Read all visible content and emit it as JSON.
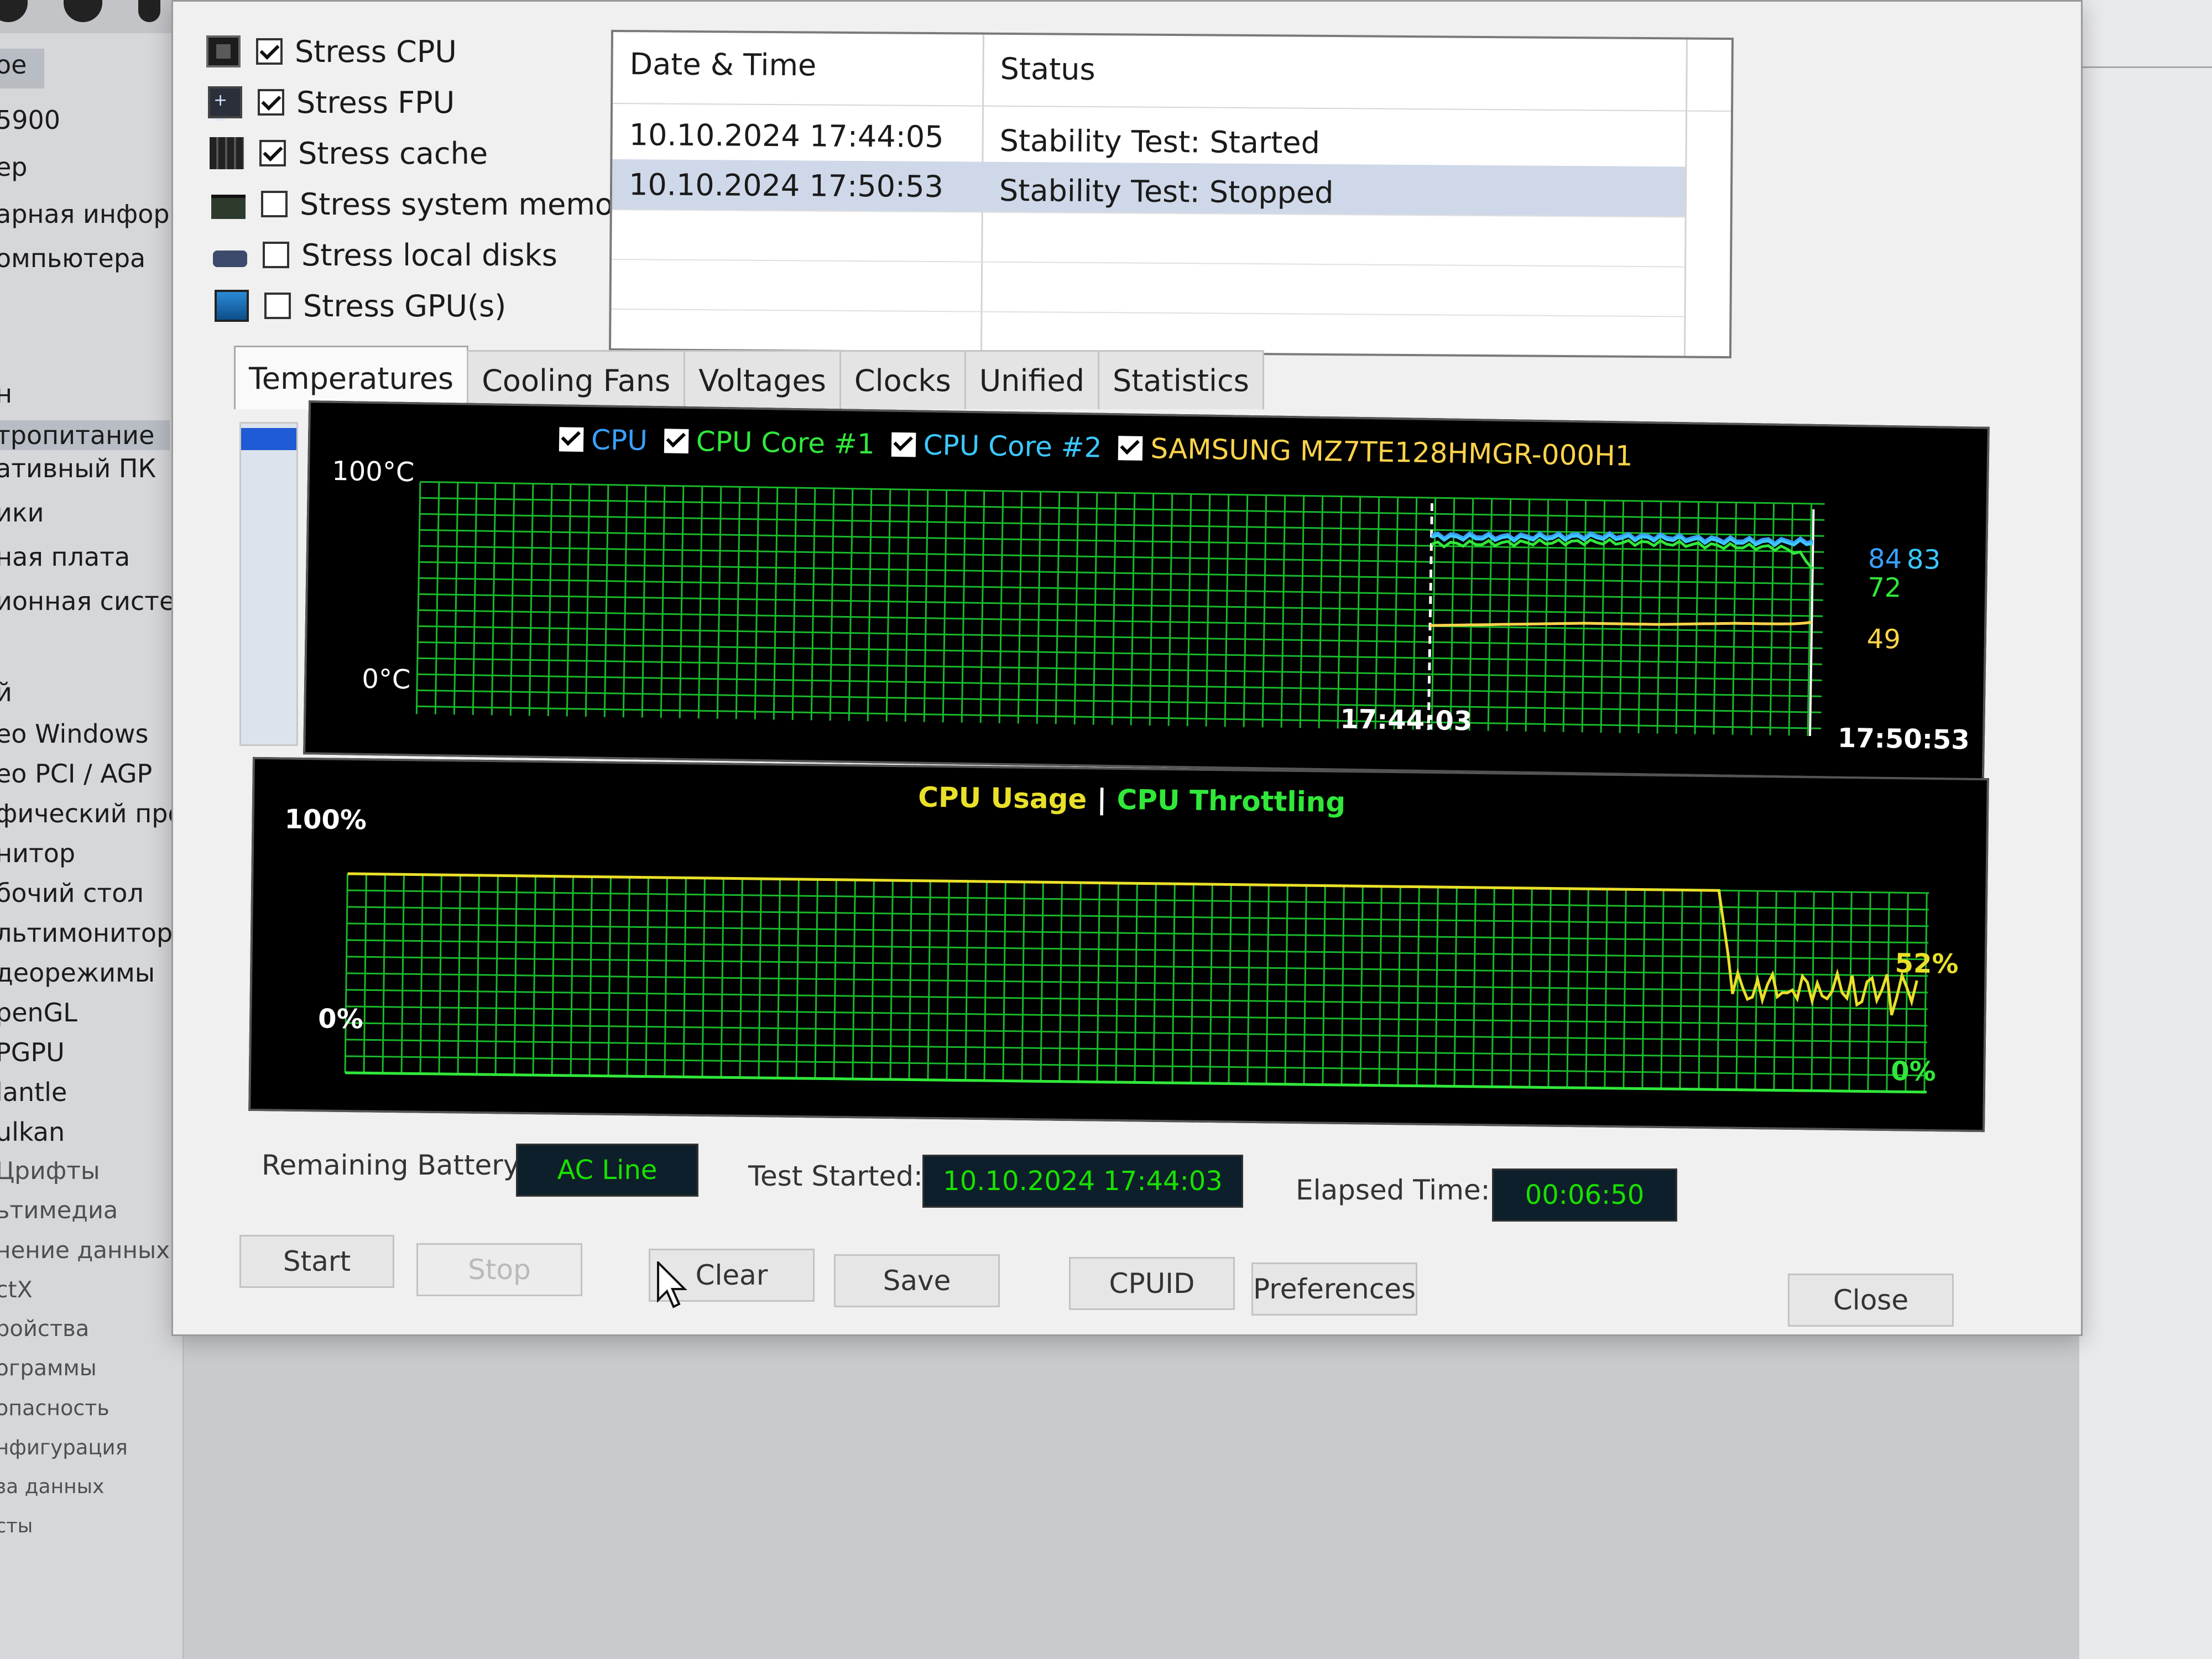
{
  "sidebar": {
    "items": [
      {
        "label": "ое",
        "active": true
      },
      {
        "label": "5900"
      },
      {
        "label": "ер"
      },
      {
        "label": "арная инфор"
      },
      {
        "label": "омпьютера"
      },
      {
        "label": "н"
      },
      {
        "label": "тропитание",
        "active": true
      },
      {
        "label": "ативный ПК"
      },
      {
        "label": "ики"
      },
      {
        "label": "ная плата"
      },
      {
        "label": "ионная систем"
      },
      {
        "label": "й"
      },
      {
        "label": "ео Windows"
      },
      {
        "label": "ео PCI / AGP"
      },
      {
        "label": "фический проц"
      },
      {
        "label": "нитор"
      },
      {
        "label": "бочий стол"
      },
      {
        "label": "льтимонитор"
      },
      {
        "label": "деорежимы"
      },
      {
        "label": "penGL"
      },
      {
        "label": "PGPU"
      },
      {
        "label": "lantle"
      },
      {
        "label": "ulkan"
      },
      {
        "label": "Црифты"
      },
      {
        "label": "ьтимедиа"
      },
      {
        "label": "нение данных"
      },
      {
        "label": "ctX"
      },
      {
        "label": "ройства"
      },
      {
        "label": "ограммы"
      },
      {
        "label": "опасность"
      },
      {
        "label": "нфигурация"
      },
      {
        "label": "за данных"
      },
      {
        "label": "сты"
      }
    ]
  },
  "stress_options": [
    {
      "label": "Stress CPU",
      "checked": true,
      "icon": "cpu-icon"
    },
    {
      "label": "Stress FPU",
      "checked": true,
      "icon": "fpu-icon"
    },
    {
      "label": "Stress cache",
      "checked": true,
      "icon": "cache-icon"
    },
    {
      "label": "Stress system memory",
      "checked": false,
      "icon": "memory-icon"
    },
    {
      "label": "Stress local disks",
      "checked": false,
      "icon": "disk-icon"
    },
    {
      "label": "Stress GPU(s)",
      "checked": false,
      "icon": "gpu-icon"
    }
  ],
  "log": {
    "headers": [
      "Date & Time",
      "Status"
    ],
    "rows": [
      {
        "datetime": "10.10.2024 17:44:05",
        "status": "Stability Test: Started",
        "selected": false
      },
      {
        "datetime": "10.10.2024 17:50:53",
        "status": "Stability Test: Stopped",
        "selected": true
      }
    ]
  },
  "tabs": [
    "Temperatures",
    "Cooling Fans",
    "Voltages",
    "Clocks",
    "Unified",
    "Statistics"
  ],
  "active_tab": "Temperatures",
  "temperature_graph": {
    "y_top_label": "100°C",
    "y_bottom_label": "0°C",
    "legend": [
      {
        "label": "CPU",
        "color": "#3aa0ff"
      },
      {
        "label": "CPU Core #1",
        "color": "#31e83a"
      },
      {
        "label": "CPU Core #2",
        "color": "#3cc8ff"
      },
      {
        "label": "SAMSUNG MZ7TE128HMGR-000H1",
        "color": "#ffd44a"
      }
    ],
    "time_start": "17:44:03",
    "time_end": "17:50:53",
    "end_values": [
      {
        "label": "84",
        "color": "#3aa0ff"
      },
      {
        "label": "83",
        "color": "#3cc8ff"
      },
      {
        "label": "72",
        "color": "#31e83a"
      },
      {
        "label": "49",
        "color": "#ffd44a"
      }
    ]
  },
  "usage_graph": {
    "title_usage": "CPU Usage",
    "separator": "|",
    "title_throttling": "CPU Throttling",
    "usage_color": "#e9e02a",
    "throttle_color": "#31e83a",
    "y_top_label": "100%",
    "y_bottom_label": "0%",
    "usage_end": "52%",
    "throttle_end": "0%"
  },
  "info": {
    "battery_label": "Remaining Battery:",
    "battery_value": "AC Line",
    "started_label": "Test Started:",
    "started_value": "10.10.2024 17:44:03",
    "elapsed_label": "Elapsed Time:",
    "elapsed_value": "00:06:50"
  },
  "buttons": {
    "start": "Start",
    "stop": "Stop",
    "clear": "Clear",
    "save": "Save",
    "cpuid": "CPUID",
    "preferences": "Preferences",
    "close": "Close"
  },
  "chart_data": [
    {
      "type": "line",
      "title": "",
      "x_labels": [
        "17:44:03",
        "17:50:53"
      ],
      "ylim": [
        0,
        100
      ],
      "series": [
        {
          "name": "CPU",
          "values": [
            84,
            84,
            85,
            85,
            84,
            84
          ]
        },
        {
          "name": "CPU Core #1",
          "values": [
            80,
            81,
            82,
            82,
            81,
            72
          ]
        },
        {
          "name": "CPU Core #2",
          "values": [
            83,
            83,
            84,
            84,
            83,
            83
          ]
        },
        {
          "name": "SAMSUNG MZ7TE128HMGR-000H1",
          "values": [
            45,
            46,
            47,
            47,
            48,
            49
          ]
        }
      ]
    },
    {
      "type": "line",
      "title": "",
      "ylim": [
        0,
        100
      ],
      "series": [
        {
          "name": "CPU Usage",
          "values": [
            100,
            100,
            100,
            100,
            100,
            52
          ]
        },
        {
          "name": "CPU Throttling",
          "values": [
            0,
            0,
            0,
            0,
            0,
            0
          ]
        }
      ]
    }
  ]
}
